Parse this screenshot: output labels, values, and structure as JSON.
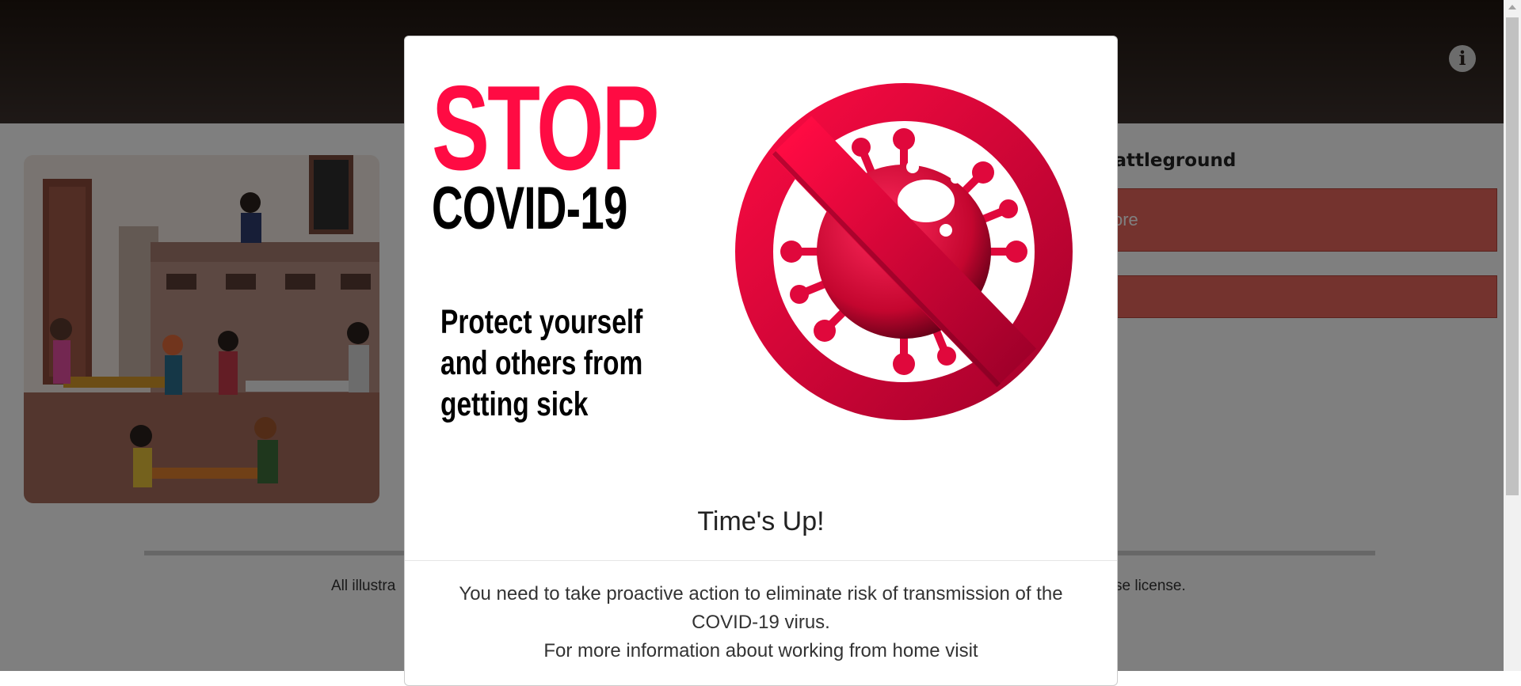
{
  "header": {
    "info_icon": "info-icon"
  },
  "page": {
    "right_title": "battleground",
    "primary_button_label": "ore",
    "footer_left": "All illustra",
    "footer_right": "se license."
  },
  "modal": {
    "poster": {
      "headline": "STOP",
      "subject": "COVID-19",
      "tagline": "Protect yourself and others from getting sick",
      "icon": "virus-prohibited-icon",
      "accent_color": "#ff0b43"
    },
    "title": "Time's Up!",
    "message_line1": "You need to take proactive action to eliminate risk of transmission of the COVID-19 virus.",
    "message_line2": "For more information about working from home visit"
  }
}
